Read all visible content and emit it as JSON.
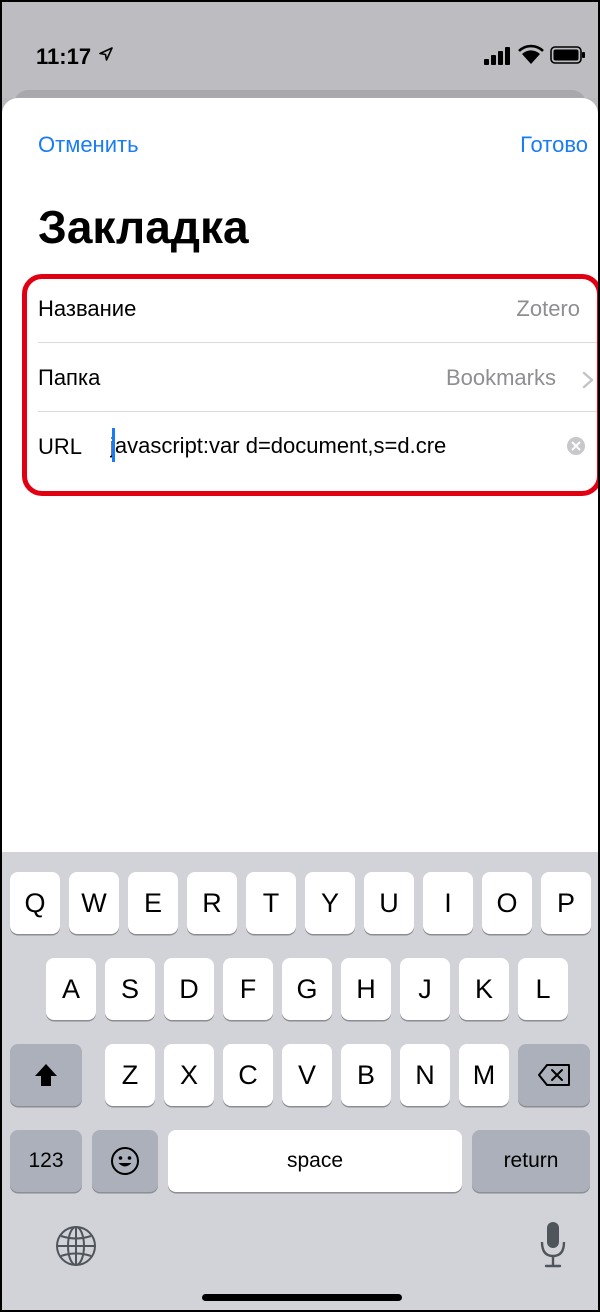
{
  "status_bar": {
    "time": "11:17"
  },
  "sheet": {
    "cancel_label": "Отменить",
    "done_label": "Готово",
    "title": "Закладка",
    "name_row": {
      "label": "Название",
      "value": "Zotero"
    },
    "folder_row": {
      "label": "Папка",
      "value": "Bookmarks"
    },
    "url_row": {
      "label": "URL",
      "value": "javascript:var d=document,s=d.cre"
    }
  },
  "colors": {
    "accent": "#1a7cf4",
    "highlight": "#e00012"
  },
  "keyboard": {
    "row1": [
      "Q",
      "W",
      "E",
      "R",
      "T",
      "Y",
      "U",
      "I",
      "O",
      "P"
    ],
    "row2": [
      "A",
      "S",
      "D",
      "F",
      "G",
      "H",
      "J",
      "K",
      "L"
    ],
    "row3": [
      "Z",
      "X",
      "C",
      "V",
      "B",
      "N",
      "M"
    ],
    "numbers_label": "123",
    "space_label": "space",
    "return_label": "return"
  }
}
